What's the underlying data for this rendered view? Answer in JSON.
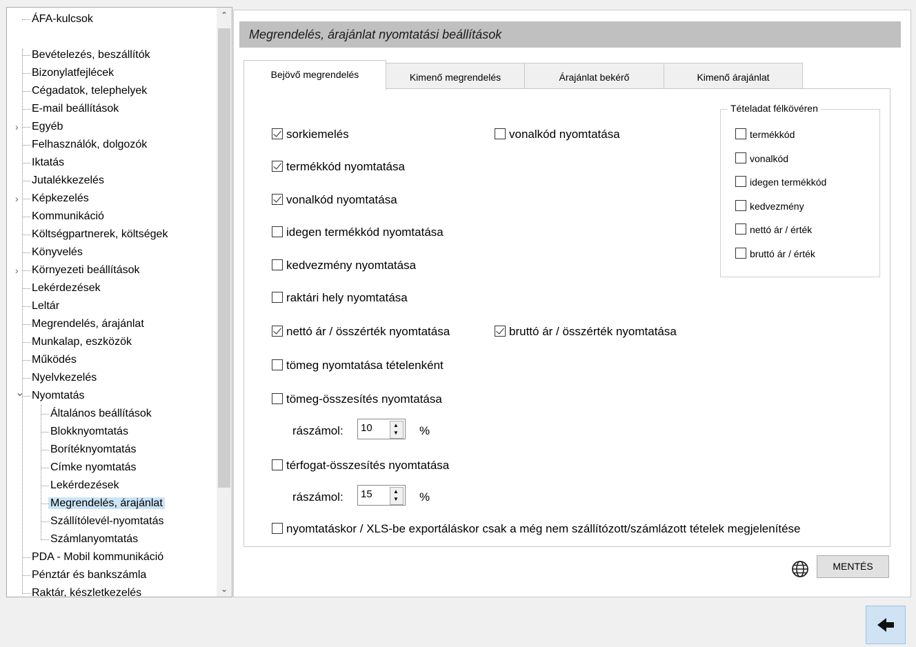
{
  "tree": {
    "items": [
      {
        "label": "ÁFA-kulcsok",
        "level": 0
      },
      {
        "label": "Bevételezés, beszállítók",
        "level": 0
      },
      {
        "label": "Bizonylatfejlécek",
        "level": 0
      },
      {
        "label": "Cégadatok, telephelyek",
        "level": 0
      },
      {
        "label": "E-mail beállítások",
        "level": 0
      },
      {
        "label": "Egyéb",
        "level": 0,
        "expandable": true
      },
      {
        "label": "Felhasználók, dolgozók",
        "level": 0
      },
      {
        "label": "Iktatás",
        "level": 0
      },
      {
        "label": "Jutalékkezelés",
        "level": 0
      },
      {
        "label": "Képkezelés",
        "level": 0,
        "expandable": true
      },
      {
        "label": "Kommunikáció",
        "level": 0
      },
      {
        "label": "Költségpartnerek, költségek",
        "level": 0
      },
      {
        "label": "Könyvelés",
        "level": 0
      },
      {
        "label": "Környezeti beállítások",
        "level": 0,
        "expandable": true
      },
      {
        "label": "Lekérdezések",
        "level": 0
      },
      {
        "label": "Leltár",
        "level": 0
      },
      {
        "label": "Megrendelés, árajánlat",
        "level": 0
      },
      {
        "label": "Munkalap, eszközök",
        "level": 0
      },
      {
        "label": "Működés",
        "level": 0
      },
      {
        "label": "Nyelvkezelés",
        "level": 0
      },
      {
        "label": "Nyomtatás",
        "level": 0,
        "expanded": true
      },
      {
        "label": "Általános beállítások",
        "level": 1
      },
      {
        "label": "Blokknyomtatás",
        "level": 1
      },
      {
        "label": "Borítéknyomtatás",
        "level": 1
      },
      {
        "label": "Címke nyomtatás",
        "level": 1
      },
      {
        "label": "Lekérdezések",
        "level": 1
      },
      {
        "label": "Megrendelés, árajánlat",
        "level": 1,
        "selected": true
      },
      {
        "label": "Szállítólevél-nyomtatás",
        "level": 1
      },
      {
        "label": "Számlanyomtatás",
        "level": 1
      },
      {
        "label": "PDA - Mobil kommunikáció",
        "level": 0
      },
      {
        "label": "Pénztár és bankszámla",
        "level": 0
      },
      {
        "label": "Raktár, készletkezelés",
        "level": 0
      }
    ]
  },
  "panel": {
    "title": "Megrendelés, árajánlat nyomtatási beállítások",
    "tabs": [
      {
        "label": "Bejövő megrendelés",
        "active": true
      },
      {
        "label": "Kimenő megrendelés"
      },
      {
        "label": "Árajánlat bekérő"
      },
      {
        "label": "Kimenő árajánlat"
      }
    ],
    "options_left": [
      {
        "label": "sorkiemelés",
        "checked": true
      },
      {
        "label": "termékkód nyomtatása",
        "checked": true
      },
      {
        "label": "vonalkód nyomtatása",
        "checked": true
      },
      {
        "label": "idegen termékkód nyomtatása",
        "checked": false
      },
      {
        "label": "kedvezmény nyomtatása",
        "checked": false
      },
      {
        "label": "raktári hely nyomtatása",
        "checked": false
      },
      {
        "label": "nettó ár / összérték nyomtatása",
        "checked": true
      },
      {
        "label": "tömeg nyomtatása tételenként",
        "checked": false
      },
      {
        "label": "tömeg-összesítés nyomtatása",
        "checked": false
      },
      {
        "label": "térfogat-összesítés nyomtatása",
        "checked": false
      },
      {
        "label": "nyomtatáskor / XLS-be exportáláskor csak a még nem szállítózott/számlázott tételek megjelenítése",
        "checked": false
      }
    ],
    "options_right": [
      {
        "label": "vonalkód nyomtatása",
        "checked": false
      },
      {
        "label": "bruttó ár / összérték nyomtatása",
        "checked": true
      }
    ],
    "bold_group": {
      "title": "Tételadat félkövéren",
      "items": [
        {
          "label": "termékkód",
          "checked": false
        },
        {
          "label": "vonalkód",
          "checked": false
        },
        {
          "label": "idegen termékkód",
          "checked": false
        },
        {
          "label": "kedvezmény",
          "checked": false
        },
        {
          "label": "nettó ár / érték",
          "checked": false
        },
        {
          "label": "bruttó ár / érték",
          "checked": false
        }
      ]
    },
    "weight_surcharge": {
      "label": "rászámol:",
      "value": "10",
      "unit": "%"
    },
    "volume_surcharge": {
      "label": "rászámol:",
      "value": "15",
      "unit": "%"
    },
    "save_label": "MENTÉS"
  },
  "icons": {
    "globe": "globe-icon",
    "back": "back-arrow-icon",
    "scroll_up": "chevron-up-icon",
    "scroll_down": "chevron-down-icon"
  }
}
